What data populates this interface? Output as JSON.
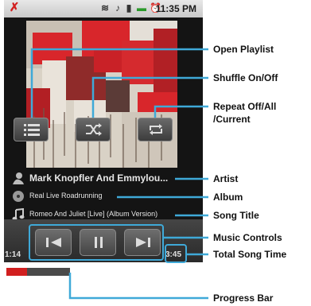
{
  "status_bar": {
    "time": "11:35 PM",
    "icons": [
      "missed-call-icon",
      "wifi-icon",
      "bluetooth-icon",
      "signal-icon",
      "battery-icon",
      "alarm-icon"
    ]
  },
  "now_playing": {
    "artist": "Mark Knopfler And Emmylou...",
    "album": "Real Live Roadrunning",
    "song": "Romeo And Juliet [Live] (Album Version)",
    "current_time": "1:14",
    "total_time": "3:45",
    "progress": 0.33
  },
  "top_controls": [
    "playlist-icon",
    "shuffle-icon",
    "repeat-icon"
  ],
  "music_controls": [
    "previous-icon",
    "pause-icon",
    "next-icon"
  ],
  "callouts": {
    "open_playlist": "Open Playlist",
    "shuffle": "Shuffle On/Off",
    "repeat_line1": "Repeat Off/All",
    "repeat_line2": "/Current",
    "artist": "Artist",
    "album": "Album",
    "song_title": "Song Title",
    "music_controls": "Music Controls",
    "total_song_time": "Total Song Time",
    "progress_bar": "Progress Bar"
  },
  "colors": {
    "callout_line": "#3fa9d8",
    "progress": "#d11f1f",
    "accent_art_red": "#d8262b"
  }
}
